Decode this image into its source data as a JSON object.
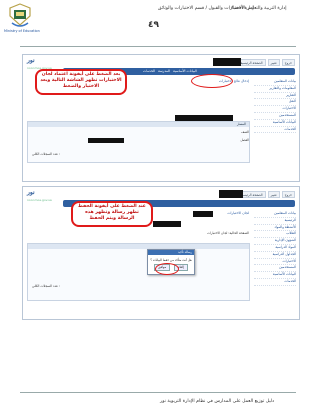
{
  "header": {
    "ministry_en": "Ministry of Education",
    "dept_line": "إدارة التربية والتعليم بالأحساء",
    "exam_line": "إدارة الاختبارات والقبول / قسم الاختبارات والوثائق",
    "page_number": "٤٩"
  },
  "app": {
    "brand": "نور",
    "brand_sub": "noor.moe.gov.sa",
    "top_links": [
      "الصفحة الرئيسية",
      "تغيير",
      "خروج"
    ],
    "tabs": [
      "البيانات الأساسية",
      "المدرسة",
      "الخدمات"
    ]
  },
  "sidebar": {
    "items": [
      "بيانات المتعلمين",
      "المعلومات والتقارير",
      "التقارير",
      "النقل",
      "الاختبارات",
      "المستخدمين",
      "البيانات الأساسية",
      "الخدمات",
      "الرئيسية",
      "الأنشطة والمواد",
      "الطلاب",
      "الشؤون الإدارية",
      "المواد الدراسية",
      "الجداول الدراسية"
    ]
  },
  "shot1": {
    "breadcrumb": "إدخال نتائج الاختبارات",
    "tabs_label": "المسار",
    "fields": [
      "الصف",
      "الفصل"
    ],
    "total_label": "عدد السجلات الكلي :",
    "callout": "بعد الضغط على أيقونة اعتماد لجان الاختبارات تظهر الشاشة التالية وبعد الاختيار والضغط"
  },
  "shot2": {
    "breadcrumb": "لجان الاختبارات",
    "info_row": "الصفحة الحالية: لجان الاختبارات",
    "total_label": "عدد السجلات الكلي :",
    "callout": "عند الضغط على أيقونة الحفظ تظهر رسالة وتظهر هذه الرسالة ويتم الحفظ",
    "dialog_title": "رسالة تأكيد",
    "dialog_msg": "هل أنت متأكد من حفظ البيانات ؟",
    "dialog_ok": "موافق",
    "dialog_cancel": "إلغاء"
  },
  "footer": "دليل توزيع العمل على المدارس في نظام الإدارة التربوية نور"
}
